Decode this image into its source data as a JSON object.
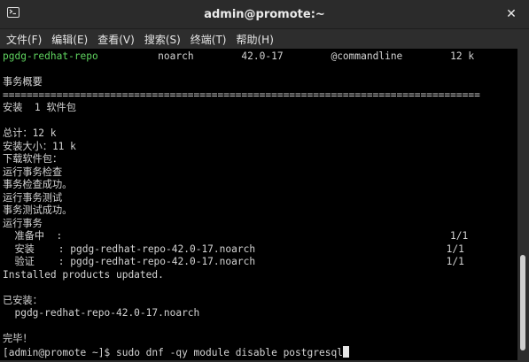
{
  "window": {
    "title": "admin@promote:~",
    "close_glyph": "✕"
  },
  "menu": [
    {
      "label": "文件(F)"
    },
    {
      "label": "编辑(E)"
    },
    {
      "label": "查看(V)"
    },
    {
      "label": "搜索(S)"
    },
    {
      "label": "终端(T)"
    },
    {
      "label": "帮助(H)"
    }
  ],
  "terminal": {
    "package_row": {
      "name": "pgdg-redhat-repo",
      "rest": "          noarch        42.0-17        @commandline        12 k"
    },
    "lines": [
      "",
      "事务概要",
      "================================================================================",
      "安装  1 软件包",
      "",
      "总计：12 k",
      "安装大小：11 k",
      "下载软件包：",
      "运行事务检查",
      "事务检查成功。",
      "运行事务测试",
      "事务测试成功。",
      "运行事务",
      "  准备中  :                                                                 1/1",
      "  安装    : pgdg-redhat-repo-42.0-17.noarch                                1/1",
      "  验证    : pgdg-redhat-repo-42.0-17.noarch                                1/1",
      "Installed products updated.",
      "",
      "已安装：",
      "  pgdg-redhat-repo-42.0-17.noarch",
      "",
      "完毕！"
    ],
    "prompt": "[admin@promote ~]$ ",
    "command": "sudo dnf -qy module disable postgresql"
  },
  "colors": {
    "terminal_bg": "#000000",
    "terminal_fg": "#d3d3d3",
    "package_name": "#5fd35f",
    "chrome_bg": "#2d2d2d"
  },
  "icons": {
    "app": "terminal-icon",
    "close": "close-icon"
  }
}
